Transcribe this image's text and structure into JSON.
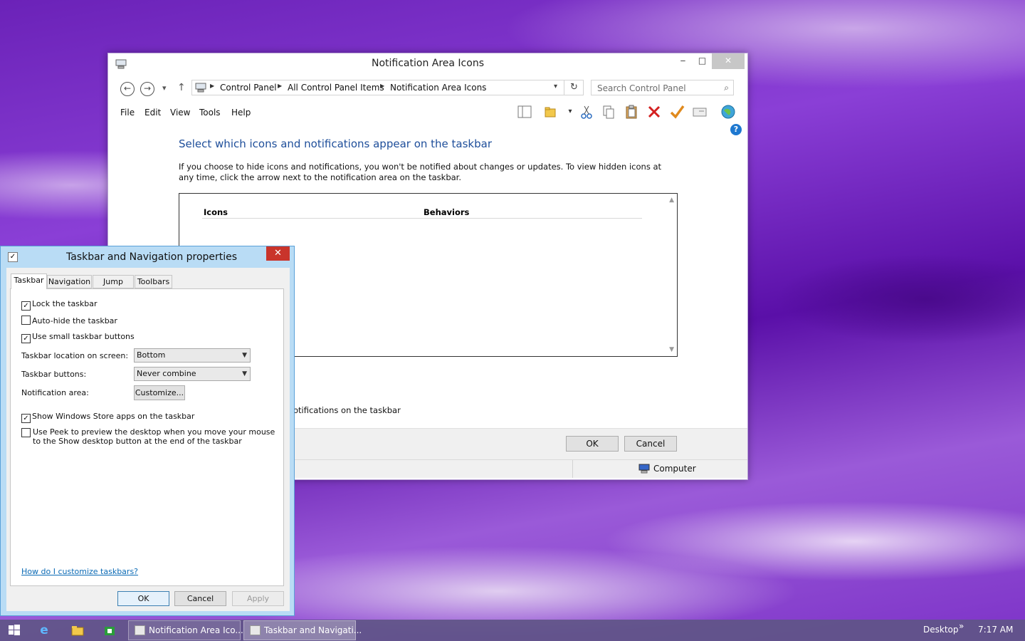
{
  "main_window": {
    "title": "Notification Area Icons",
    "caption": {
      "minimize": "‒",
      "maximize": "□",
      "close": "✕"
    },
    "nav": {
      "back": "←",
      "forward": "→",
      "recent": "▾",
      "up": "↑"
    },
    "breadcrumbs": [
      "Control Panel",
      "All Control Panel Items",
      "Notification Area Icons"
    ],
    "search_placeholder": "Search Control Panel",
    "menu": [
      "File",
      "Edit",
      "View",
      "Tools",
      "Help"
    ],
    "toolbar_icons": [
      "preview-pane-icon",
      "folder-icon",
      "cut-icon",
      "copy-icon",
      "paste-icon",
      "delete-icon",
      "properties-check-icon",
      "rename-icon",
      "globe-icon",
      "help-icon"
    ],
    "heading": "Select which icons and notifications appear on the taskbar",
    "description": "If you choose to hide icons and notifications, you won't be notified about changes or updates. To view hidden icons at any time, click the arrow next to the notification area on the taskbar.",
    "columns": [
      "Icons",
      "Behaviors"
    ],
    "always_show_text": "otifications on the taskbar",
    "ok_label": "OK",
    "cancel_label": "Cancel",
    "status_computer": "Computer"
  },
  "dialog": {
    "title": "Taskbar and Navigation properties",
    "close": "✕",
    "tabs": [
      "Taskbar",
      "Navigation",
      "Jump Lists",
      "Toolbars"
    ],
    "active_tab": "Taskbar",
    "checkboxes": {
      "lock": {
        "label": "Lock the taskbar",
        "checked": true
      },
      "autohide": {
        "label": "Auto-hide the taskbar",
        "checked": false
      },
      "small": {
        "label": "Use small taskbar buttons",
        "checked": true
      },
      "store": {
        "label": "Show Windows Store apps on the taskbar",
        "checked": true
      },
      "peek": {
        "label": "Use Peek to preview the desktop when you move your mouse to the Show desktop button at the end of the taskbar",
        "checked": false
      }
    },
    "location_label": "Taskbar location on screen:",
    "location_value": "Bottom",
    "buttons_label": "Taskbar buttons:",
    "buttons_value": "Never combine",
    "notif_label": "Notification area:",
    "customize_label": "Customize...",
    "help_link": "How do I customize taskbars?",
    "ok": "OK",
    "cancel": "Cancel",
    "apply": "Apply"
  },
  "taskbar": {
    "tasks": [
      "Notification Area Ico...",
      "Taskbar and Navigati..."
    ],
    "desktop_label": "Desktop",
    "chevron": "»",
    "time": "7:17 AM"
  }
}
